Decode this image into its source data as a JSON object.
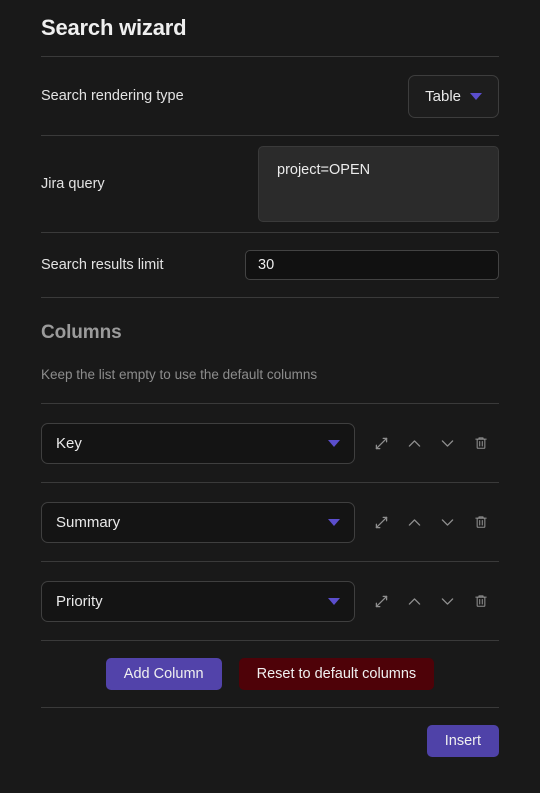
{
  "dialog": {
    "title": "Search wizard"
  },
  "rendering_type": {
    "label": "Search rendering type",
    "value": "Table",
    "caret_icon": "chevron-down-icon"
  },
  "jira_query": {
    "label": "Jira query",
    "value": "project=OPEN",
    "placeholder": ""
  },
  "results_limit": {
    "label": "Search results limit",
    "value": "30",
    "placeholder": ""
  },
  "columns": {
    "heading": "Columns",
    "hint": "Keep the list empty to use the default columns",
    "rows": [
      {
        "value": "Key"
      },
      {
        "value": "Summary"
      },
      {
        "value": "Priority"
      }
    ],
    "row_icons": {
      "expand": "expand-diagonal-icon",
      "move_up": "chevron-up-icon",
      "move_down": "chevron-down-icon",
      "delete": "trash-icon"
    },
    "add_label": "Add Column",
    "reset_label": "Reset to default columns"
  },
  "footer": {
    "insert_label": "Insert"
  },
  "colors": {
    "background": "#191919",
    "accent_purple": "#5243aa",
    "caret_purple": "#5b4ecd",
    "danger_red": "#4e0208",
    "divider": "#3a3a3a",
    "text_primary": "#e6e6e6",
    "text_muted": "#8d8d8d"
  }
}
